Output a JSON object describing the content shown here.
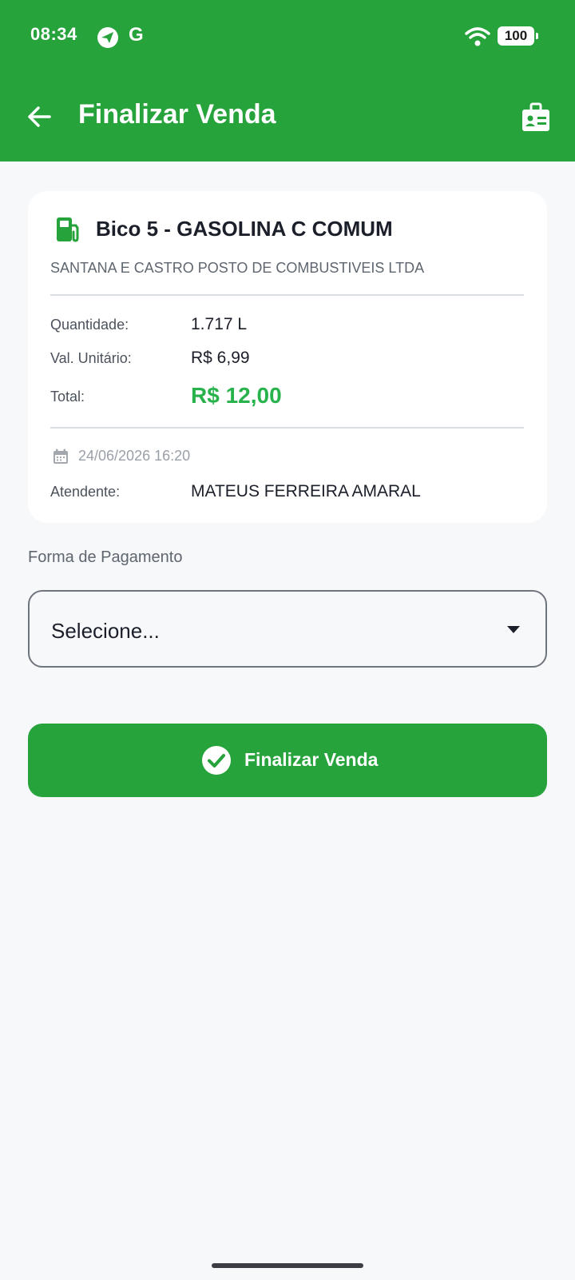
{
  "status_bar": {
    "time": "08:34",
    "g_label": "G",
    "battery": "100"
  },
  "header": {
    "title": "Finalizar Venda"
  },
  "sale": {
    "pump": "Bico 5 - GASOLINA C COMUM",
    "station": "SANTANA E CASTRO POSTO DE COMBUSTIVEIS LTDA",
    "quantity_label": "Quantidade:",
    "quantity": "1.717 L",
    "unit_price_label": "Val. Unitário:",
    "unit_price": "R$ 6,99",
    "total_label": "Total:",
    "total": "R$ 12,00",
    "datetime": "24/06/2026 16:20",
    "attendant_label": "Atendente:",
    "attendant": "MATEUS FERREIRA AMARAL"
  },
  "payment": {
    "label": "Forma de Pagamento",
    "selected": "Selecione..."
  },
  "actions": {
    "finalize_label": "Finalizar Venda"
  },
  "colors": {
    "brand": "#26a33b",
    "total": "#28b24b"
  },
  "icons": [
    "navigation-icon",
    "wifi-icon",
    "back-arrow-icon",
    "id-badge-icon",
    "fuel-pump-icon",
    "calendar-icon",
    "caret-down-icon",
    "check-circle-icon"
  ]
}
